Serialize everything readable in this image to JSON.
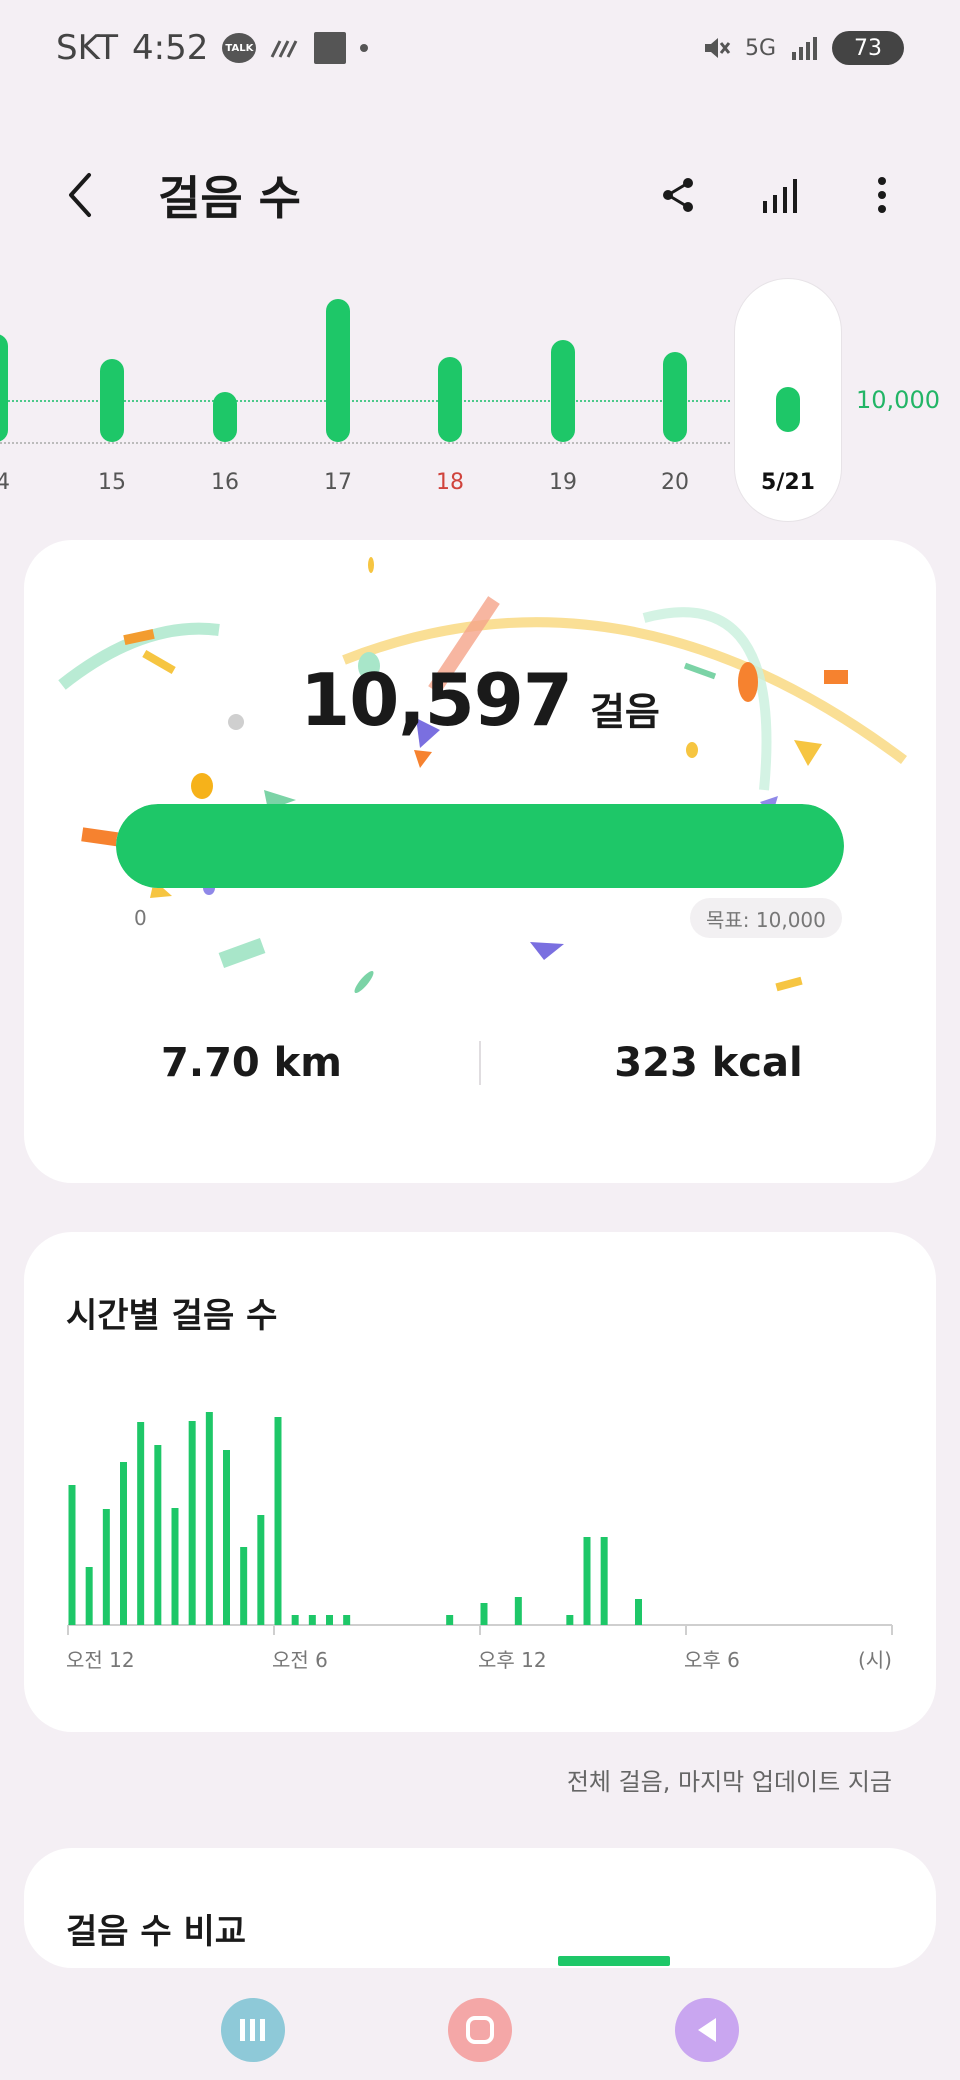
{
  "status_bar": {
    "carrier": "SKT",
    "time": "4:52",
    "talk_badge": "TALK",
    "network": "5G",
    "battery": "73"
  },
  "header": {
    "title": "걸음 수"
  },
  "day_strip": {
    "goal_label": "10,000",
    "days": [
      {
        "label": "14",
        "level": 0.72,
        "weekend": false,
        "selected": false
      },
      {
        "label": "15",
        "level": 0.55,
        "weekend": false,
        "selected": false
      },
      {
        "label": "16",
        "level": 0.33,
        "weekend": false,
        "selected": false
      },
      {
        "label": "17",
        "level": 0.95,
        "weekend": false,
        "selected": false
      },
      {
        "label": "18",
        "level": 0.57,
        "weekend": true,
        "selected": false
      },
      {
        "label": "19",
        "level": 0.68,
        "weekend": false,
        "selected": false
      },
      {
        "label": "20",
        "level": 0.6,
        "weekend": false,
        "selected": false
      },
      {
        "label": "5/21",
        "level": 0.3,
        "weekend": false,
        "selected": true
      }
    ]
  },
  "summary": {
    "steps_value": "10,597",
    "steps_unit": "걸음",
    "progress_min": "0",
    "goal_pill": "목표: 10,000",
    "progress_fraction": 1.0,
    "distance": "7.70 km",
    "calories": "323 kcal"
  },
  "hourly": {
    "title": "시간별 걸음 수",
    "footnote": "전체 걸음, 마지막 업데이트 지금"
  },
  "compare": {
    "title": "걸음 수 비교"
  },
  "chart_data": {
    "type": "bar",
    "title": "시간별 걸음 수",
    "xlabel": "",
    "ylabel": "",
    "x_tick_labels": [
      "오전 12",
      "오전 6",
      "오후 12",
      "오후 6",
      "(시)"
    ],
    "x_unit": "(시)",
    "categories": [
      0,
      0.5,
      1,
      1.5,
      2,
      2.5,
      3,
      3.5,
      4,
      4.5,
      5,
      5.5,
      6,
      6.5,
      7,
      7.5,
      8,
      8.5,
      9,
      9.5,
      10,
      10.5,
      11,
      11.5,
      12,
      12.5,
      13,
      13.5,
      14,
      14.5,
      15,
      15.5,
      16,
      16.5,
      17,
      17.5,
      18,
      18.5,
      19,
      19.5,
      20,
      20.5,
      21,
      21.5,
      22,
      22.5,
      23,
      23.5
    ],
    "values": [
      140,
      58,
      116,
      163,
      203,
      180,
      117,
      204,
      213,
      175,
      78,
      110,
      208,
      10,
      10,
      10,
      10,
      0,
      0,
      0,
      0,
      0,
      10,
      0,
      22,
      0,
      28,
      0,
      0,
      10,
      88,
      88,
      0,
      26,
      0,
      0,
      0,
      0,
      0,
      0,
      0,
      0,
      0,
      0,
      0,
      0,
      0,
      0
    ],
    "ylim": [
      0,
      220
    ],
    "grid": false,
    "colors": {
      "bar": "#1ec768",
      "axis": "#cfcfcf"
    }
  },
  "nav": {
    "recent_icon": "recent-apps-icon",
    "home_icon": "home-icon",
    "back_icon": "back-icon"
  }
}
